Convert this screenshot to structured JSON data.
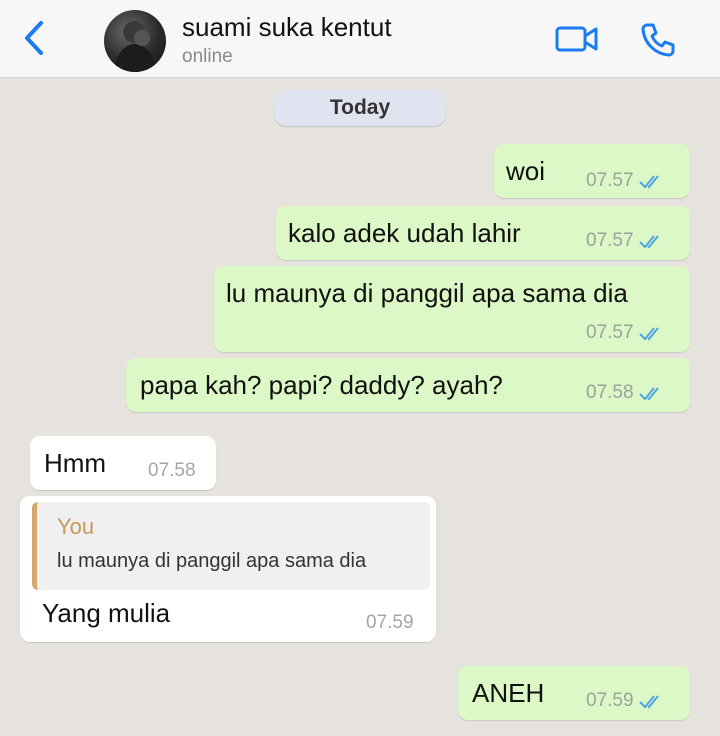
{
  "header": {
    "contact_name": "suami suka kentut",
    "status": "online"
  },
  "date_chip": "Today",
  "messages": [
    {
      "text": "woi",
      "time": "07.57",
      "direction": "outgoing",
      "read": true
    },
    {
      "text": "kalo adek udah lahir",
      "time": "07.57",
      "direction": "outgoing",
      "read": true
    },
    {
      "text": "lu maunya di panggil apa sama dia",
      "time": "07.57",
      "direction": "outgoing",
      "read": true
    },
    {
      "text": "papa kah? papi? daddy? ayah?",
      "time": "07.58",
      "direction": "outgoing",
      "read": true
    },
    {
      "text": "Hmm",
      "time": "07.58",
      "direction": "incoming"
    },
    {
      "text": "Yang mulia",
      "time": "07.59",
      "direction": "incoming",
      "reply": {
        "author": "You",
        "text": "lu maunya di panggil apa sama dia"
      }
    },
    {
      "text": "ANEH",
      "time": "07.59",
      "direction": "outgoing",
      "read": true
    }
  ],
  "colors": {
    "accent": "#1a7cf0",
    "outgoing_bubble": "#dcf8c6",
    "incoming_bubble": "#ffffff",
    "read_ticks": "#4fa3e0",
    "reply_bar": "#d2a86e",
    "chat_background": "#e6e3de"
  },
  "icons": {
    "back": "chevron-left-icon",
    "video": "video-camera-icon",
    "call": "phone-icon",
    "read_receipt": "double-check-icon"
  }
}
